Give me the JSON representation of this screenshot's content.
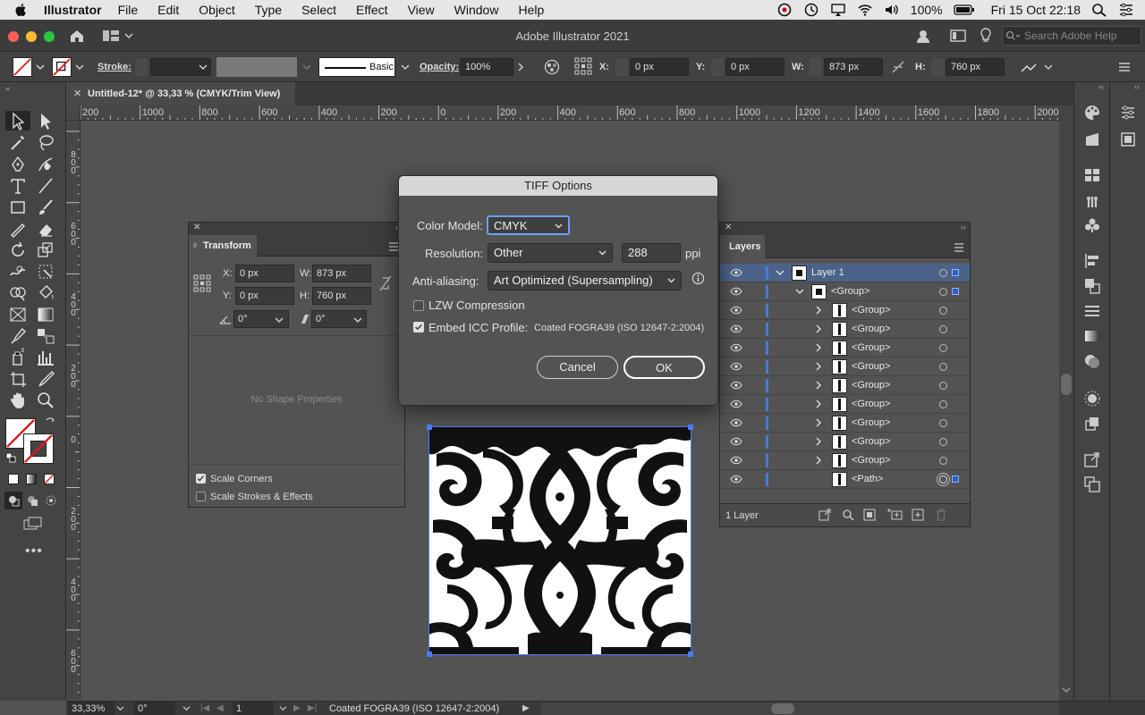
{
  "menubar": {
    "app_name": "Illustrator",
    "items": [
      "File",
      "Edit",
      "Object",
      "Type",
      "Select",
      "Effect",
      "View",
      "Window",
      "Help"
    ],
    "battery": "100%",
    "datetime": "Fri 15 Oct  22:18"
  },
  "window": {
    "title": "Adobe Illustrator 2021",
    "search_placeholder": "Search Adobe Help"
  },
  "controlbar": {
    "stroke_label": "Stroke:",
    "brush_label": "Basic",
    "opacity_label": "Opacity:",
    "opacity_value": "100%",
    "x_label": "X:",
    "x_value": "0 px",
    "y_label": "Y:",
    "y_value": "0 px",
    "w_label": "W:",
    "w_value": "873 px",
    "h_label": "H:",
    "h_value": "760 px"
  },
  "document_tab": {
    "title": "Untitled-12* @ 33,33 % (CMYK/Trim View)"
  },
  "ruler": {
    "h_labels": [
      "200",
      "1000",
      "800",
      "600",
      "400",
      "200",
      "0",
      "200",
      "400",
      "600",
      "800",
      "1000",
      "1200",
      "1400",
      "1600",
      "1800",
      "2000"
    ],
    "v_labels": [
      "800",
      "600",
      "400",
      "200",
      "0",
      "200",
      "400",
      "600"
    ]
  },
  "transform_panel": {
    "title": "Transform",
    "x_label": "X:",
    "x_value": "0 px",
    "y_label": "Y:",
    "y_value": "0 px",
    "w_label": "W:",
    "w_value": "873 px",
    "h_label": "H:",
    "h_value": "760 px",
    "angle_value": "0°",
    "shear_value": "0°",
    "empty_text": "No Shape Properties",
    "scale_corners": "Scale Corners",
    "scale_strokes": "Scale Strokes & Effects"
  },
  "layers_panel": {
    "title": "Layers",
    "rows": [
      {
        "name": "Layer 1",
        "indent": 0
      },
      {
        "name": "<Group>",
        "indent": 1
      },
      {
        "name": "<Group>",
        "indent": 2
      },
      {
        "name": "<Group>",
        "indent": 2
      },
      {
        "name": "<Group>",
        "indent": 2
      },
      {
        "name": "<Group>",
        "indent": 2
      },
      {
        "name": "<Group>",
        "indent": 2
      },
      {
        "name": "<Group>",
        "indent": 2
      },
      {
        "name": "<Group>",
        "indent": 2
      },
      {
        "name": "<Group>",
        "indent": 2
      },
      {
        "name": "<Group>",
        "indent": 2
      },
      {
        "name": "<Path>",
        "indent": 2
      }
    ],
    "count_label": "1 Layer"
  },
  "dialog": {
    "title": "TIFF Options",
    "color_model_label": "Color Model:",
    "color_model_value": "CMYK",
    "resolution_label": "Resolution:",
    "resolution_value": "Other",
    "resolution_ppi": "288",
    "ppi_unit": "ppi",
    "antialias_label": "Anti-aliasing:",
    "antialias_value": "Art Optimized (Supersampling)",
    "lzw_label": "LZW Compression",
    "lzw_checked": false,
    "icc_label": "Embed ICC Profile:",
    "icc_checked": true,
    "icc_profile": "Coated FOGRA39 (ISO 12647-2:2004)",
    "cancel_label": "Cancel",
    "ok_label": "OK"
  },
  "statusbar": {
    "zoom": "33,33%",
    "rotation": "0°",
    "artboard": "1",
    "profile": "Coated FOGRA39 (ISO 12647-2:2004)"
  },
  "colors": {
    "accent": "#4a7bd6",
    "panel_bg": "#535353",
    "dark_bg": "#3d3d3d"
  }
}
